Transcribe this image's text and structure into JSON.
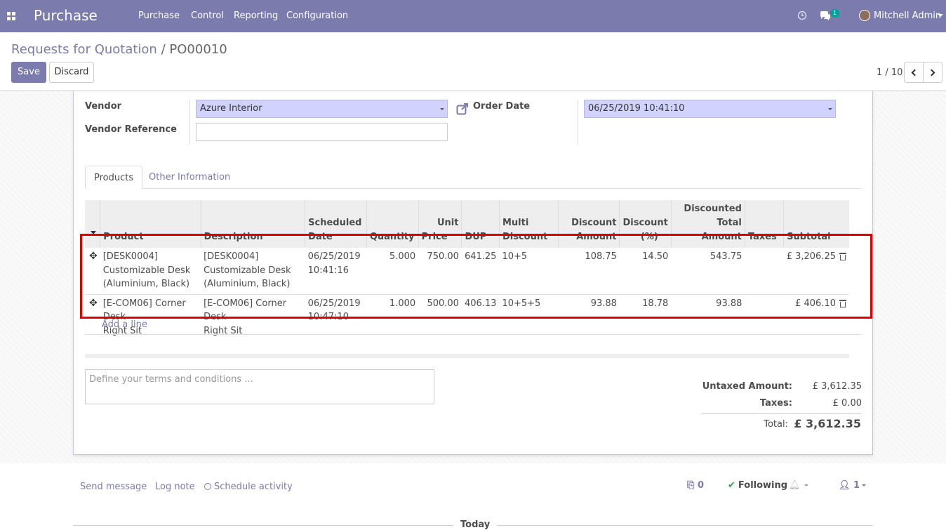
{
  "navbar": {
    "app_name": "Purchase",
    "menu": [
      "Purchase",
      "Control",
      "Reporting",
      "Configuration"
    ],
    "messages_badge": "1",
    "user": "Mitchell Admin"
  },
  "breadcrumb": {
    "parent": "Requests for Quotation",
    "separator": "/",
    "current": "PO00010"
  },
  "actions": {
    "save": "Save",
    "discard": "Discard"
  },
  "pager": {
    "value": "1 / 10"
  },
  "form": {
    "vendor_label": "Vendor",
    "vendor_value": "Azure Interior",
    "vendor_ref_label": "Vendor Reference",
    "vendor_ref_value": "",
    "order_date_label": "Order Date",
    "order_date_value": "06/25/2019 10:41:10"
  },
  "tabs": [
    "Products",
    "Other Information"
  ],
  "lines": {
    "headers": {
      "product": "Product",
      "description": "Description",
      "sched1": "Scheduled",
      "sched2": "Date",
      "quantity": "Quantity",
      "price1": "Unit",
      "price2": "Price",
      "dup": "DUP",
      "multi1": "Multi",
      "multi2": "Discount",
      "disc_amt1": "Discount",
      "disc_amt2": "Amount",
      "disc_pct1": "Discount",
      "disc_pct2": "(%)",
      "disc_total1": "Discounted",
      "disc_total2": "Total Amount",
      "taxes": "Taxes",
      "subtotal": "Subtotal"
    },
    "rows": [
      {
        "product_l1": "[DESK0004]",
        "product_l2": "Customizable Desk",
        "product_l3": "(Aluminium, Black)",
        "desc_l1": "[DESK0004]",
        "desc_l2": "Customizable Desk",
        "desc_l3": "(Aluminium, Black)",
        "date_l1": "06/25/2019",
        "date_l2": "10:41:16",
        "quantity": "5.000",
        "unit_price": "750.00",
        "dup": "641.25",
        "multi_discount": "10+5",
        "discount_amount": "108.75",
        "discount_pct": "14.50",
        "discounted_total": "543.75",
        "taxes": "",
        "subtotal": "£ 3,206.25"
      },
      {
        "product_l1": "[E-COM06] Corner Desk",
        "product_l2": "Right Sit",
        "product_l3": "",
        "desc_l1": "[E-COM06] Corner Desk",
        "desc_l2": "Right Sit",
        "desc_l3": "",
        "date_l1": "06/25/2019",
        "date_l2": "10:47:10",
        "quantity": "1.000",
        "unit_price": "500.00",
        "dup": "406.13",
        "multi_discount": "10+5+5",
        "discount_amount": "93.88",
        "discount_pct": "18.78",
        "discounted_total": "93.88",
        "taxes": "",
        "subtotal": "£ 406.10"
      }
    ],
    "add_line": "Add a line"
  },
  "terms_placeholder": "Define your terms and conditions ...",
  "totals": {
    "untaxed_label": "Untaxed Amount:",
    "untaxed_value": "£ 3,612.35",
    "taxes_label": "Taxes:",
    "taxes_value": "£ 0.00",
    "total_label": "Total:",
    "total_value": "£ 3,612.35"
  },
  "chatter": {
    "send_message": "Send message",
    "log_note": "Log note",
    "schedule_activity": "Schedule activity",
    "attachments": "0",
    "following": "Following",
    "followers": "1",
    "today": "Today"
  },
  "colors": {
    "brand": "#7c7bad",
    "highlight": "#e00000",
    "required_field": "#d2d2ff"
  }
}
